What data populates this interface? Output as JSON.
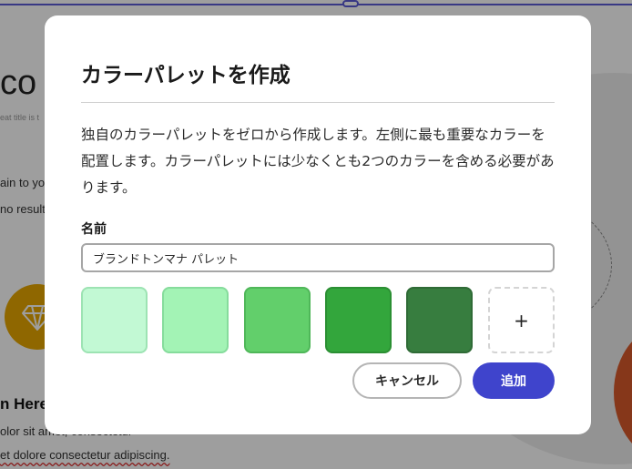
{
  "background": {
    "heading": "co",
    "subtitle": "eat title is t",
    "line1": "ain to yo",
    "line2": "no result",
    "section_heading": "n Here",
    "para1": "olor sit amet, consectetur",
    "para2": "et dolore consectetur adipiscing."
  },
  "modal": {
    "title": "カラーパレットを作成",
    "description": "独自のカラーパレットをゼロから作成します。左側に最も重要なカラーを配置します。カラーパレットには少なくとも2つのカラーを含める必要があります。",
    "name_label": "名前",
    "name_value": "ブランドトンマナ パレット",
    "swatches": [
      {
        "fill": "#c2f9d4",
        "border": "#9de3b3"
      },
      {
        "fill": "#a3f3b5",
        "border": "#86dc9c"
      },
      {
        "fill": "#62cf6b",
        "border": "#4fb759"
      },
      {
        "fill": "#33a63c",
        "border": "#2b8f33"
      },
      {
        "fill": "#377d3f",
        "border": "#2f6b36"
      }
    ],
    "add_swatch_symbol": "+",
    "cancel_label": "キャンセル",
    "add_label": "追加"
  }
}
